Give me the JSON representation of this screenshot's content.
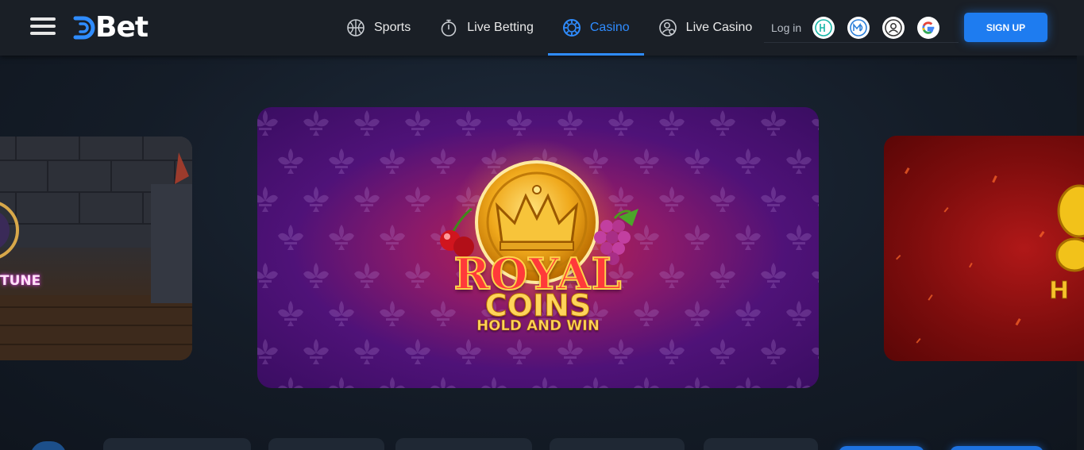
{
  "header": {
    "logo_text": "Bet",
    "nav": [
      {
        "label": "Sports",
        "icon": "basketball-icon",
        "active": false
      },
      {
        "label": "Live Betting",
        "icon": "stopwatch-icon",
        "active": false
      },
      {
        "label": "Casino",
        "icon": "casino-chip-icon",
        "active": true
      },
      {
        "label": "Live Casino",
        "icon": "live-dealer-icon",
        "active": false
      }
    ],
    "login_label": "Log in",
    "social_icons": [
      "metamask-wallet-icon",
      "wallet-connect-icon",
      "user-account-icon",
      "google-icon"
    ],
    "signup_label": "SIGN UP"
  },
  "carousel": {
    "main": {
      "line1": "ROYAL",
      "line2": "COINS",
      "line3": "HOLD AND WIN"
    },
    "left_partial_text": "TUNE",
    "right_partial_text": "H"
  },
  "colors": {
    "accent": "#2f8cff",
    "header_bg": "#1a1f26",
    "signup_bg": "#1e7cf0"
  }
}
